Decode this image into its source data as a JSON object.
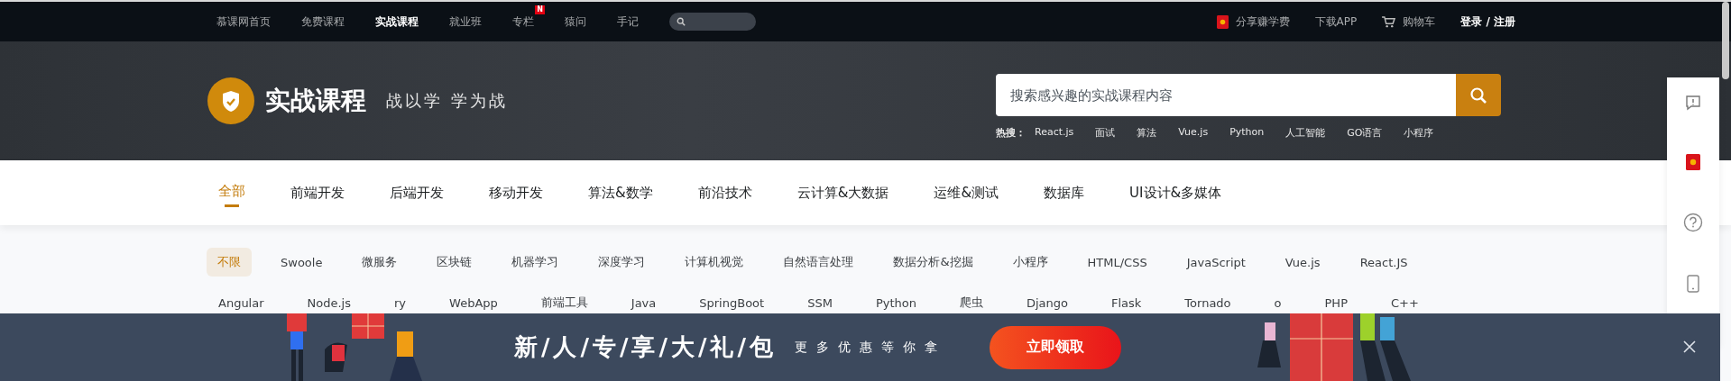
{
  "topbar": {
    "nav": [
      {
        "label": "慕课网首页",
        "selected": false
      },
      {
        "label": "免费课程",
        "selected": false
      },
      {
        "label": "实战课程",
        "selected": true
      },
      {
        "label": "就业班",
        "selected": false
      },
      {
        "label": "专栏",
        "selected": false,
        "badge": "N"
      },
      {
        "label": "猿问",
        "selected": false
      },
      {
        "label": "手记",
        "selected": false
      }
    ],
    "share": "分享赚学费",
    "download": "下载APP",
    "cart": "购物车",
    "login": "登录 / 注册"
  },
  "header": {
    "title": "实战课程",
    "slogan": "战以学 学为战",
    "search": {
      "placeholder": "搜索感兴趣的实战课程内容"
    },
    "hot_label": "热搜：",
    "hot": [
      "React.js",
      "面试",
      "算法",
      "Vue.js",
      "Python",
      "人工智能",
      "GO语言",
      "小程序"
    ]
  },
  "categories": [
    {
      "label": "全部",
      "selected": true
    },
    {
      "label": "前端开发",
      "selected": false
    },
    {
      "label": "后端开发",
      "selected": false
    },
    {
      "label": "移动开发",
      "selected": false
    },
    {
      "label": "算法&数学",
      "selected": false
    },
    {
      "label": "前沿技术",
      "selected": false
    },
    {
      "label": "云计算&大数据",
      "selected": false
    },
    {
      "label": "运维&测试",
      "selected": false
    },
    {
      "label": "数据库",
      "selected": false
    },
    {
      "label": "UI设计&多媒体",
      "selected": false
    }
  ],
  "tags": [
    {
      "items": [
        {
          "label": "不限",
          "selected": true
        },
        {
          "label": "Swoole",
          "selected": false
        },
        {
          "label": "微服务",
          "selected": false
        },
        {
          "label": "区块链",
          "selected": false
        },
        {
          "label": "机器学习",
          "selected": false
        },
        {
          "label": "深度学习",
          "selected": false
        },
        {
          "label": "计算机视觉",
          "selected": false
        },
        {
          "label": "自然语言处理",
          "selected": false
        },
        {
          "label": "数据分析&挖掘",
          "selected": false
        },
        {
          "label": "小程序",
          "selected": false
        },
        {
          "label": "HTML/CSS",
          "selected": false
        },
        {
          "label": "JavaScript",
          "selected": false
        },
        {
          "label": "Vue.js",
          "selected": false
        },
        {
          "label": "React.JS",
          "selected": false
        }
      ]
    },
    {
      "items": [
        {
          "label": "Angular",
          "selected": false
        },
        {
          "label": "Node.js",
          "selected": false
        },
        {
          "label": "ry",
          "selected": false
        },
        {
          "label": "WebApp",
          "selected": false
        },
        {
          "label": "前端工具",
          "selected": false
        },
        {
          "label": "Java",
          "selected": false
        },
        {
          "label": "SpringBoot",
          "selected": false
        },
        {
          "label": "SSM",
          "selected": false
        },
        {
          "label": "Python",
          "selected": false
        },
        {
          "label": "爬虫",
          "selected": false
        },
        {
          "label": "Django",
          "selected": false
        },
        {
          "label": "Flask",
          "selected": false
        },
        {
          "label": "Tornado",
          "selected": false
        },
        {
          "label": "o",
          "selected": false
        },
        {
          "label": "PHP",
          "selected": false
        },
        {
          "label": "C++",
          "selected": false
        }
      ]
    }
  ],
  "banner": {
    "title": "新/人/专/享/大/礼/包",
    "subtitle": "更多优惠等你拿",
    "button": "立即领取"
  }
}
